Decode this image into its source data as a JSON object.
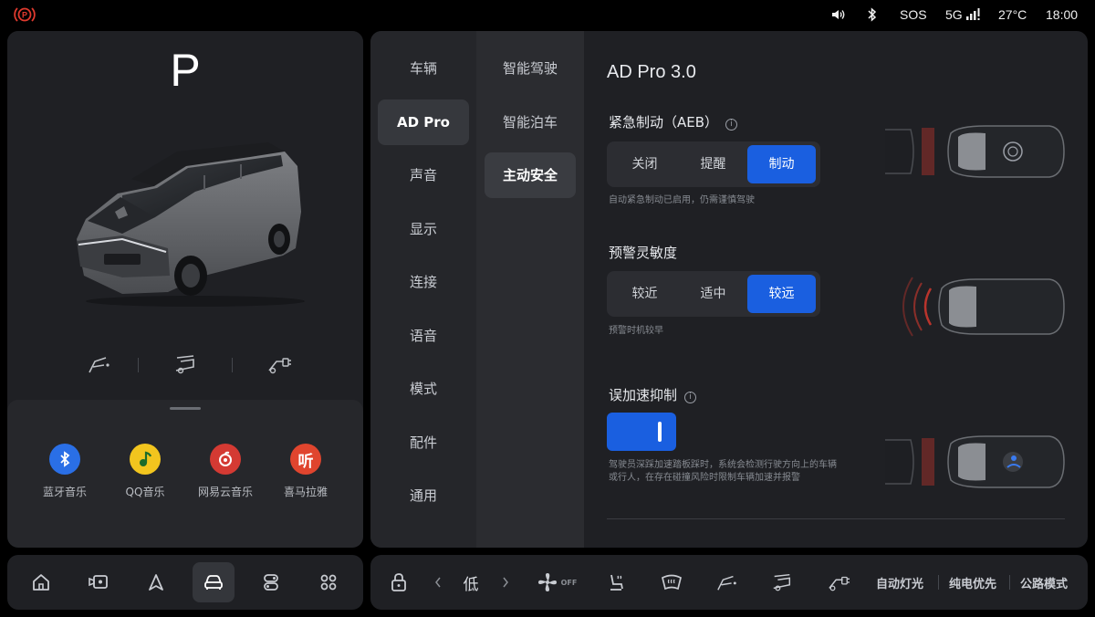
{
  "status_bar": {
    "brake_warning_icon": "parking-brake-warning-icon",
    "brake_warning_color": "#e03a2e",
    "sos": "SOS",
    "network": "5G",
    "temperature": "27°C",
    "time": "18:00"
  },
  "vehicle": {
    "gear": "P"
  },
  "media": {
    "apps": [
      {
        "label": "蓝牙音乐",
        "color": "#2a6fe6",
        "icon": "bluetooth-icon"
      },
      {
        "label": "QQ音乐",
        "color": "#f2c51e",
        "icon": "qq-music-icon"
      },
      {
        "label": "网易云音乐",
        "color": "#d43a33",
        "icon": "netease-music-icon"
      },
      {
        "label": "喜马拉雅",
        "color": "#e0452e",
        "icon": "ximalaya-icon"
      }
    ],
    "ximalaya_glyph": "听"
  },
  "settings": {
    "menu_primary": [
      "车辆",
      "AD Pro",
      "声音",
      "显示",
      "连接",
      "语音",
      "模式",
      "配件",
      "通用"
    ],
    "menu_primary_active": "AD Pro",
    "menu_secondary": [
      "智能驾驶",
      "智能泊车",
      "主动安全"
    ],
    "menu_secondary_active": "主动安全",
    "title": "AD Pro 3.0",
    "aeb": {
      "title": "紧急制动（AEB）",
      "options": [
        "关闭",
        "提醒",
        "制动"
      ],
      "selected": "制动",
      "note": "自动紧急制动已启用，仍需谨慎驾驶"
    },
    "sensitivity": {
      "title": "预警灵敏度",
      "options": [
        "较近",
        "适中",
        "较远"
      ],
      "selected": "较远",
      "note": "预警时机较早"
    },
    "misaccel": {
      "title": "误加速抑制",
      "enabled": true,
      "note_line1": "驾驶员深踩加速踏板踩时，系统会检测行驶方向上的车辆",
      "note_line2": "或行人，在存在碰撞风险时限制车辆加速并报警"
    }
  },
  "dock": {
    "climate_level": "低",
    "fan_state": "OFF",
    "quick_actions": [
      "自动灯光",
      "纯电优先",
      "公路模式"
    ]
  },
  "colors": {
    "accent": "#1a5fe0",
    "warning_red": "#e03a2e"
  }
}
